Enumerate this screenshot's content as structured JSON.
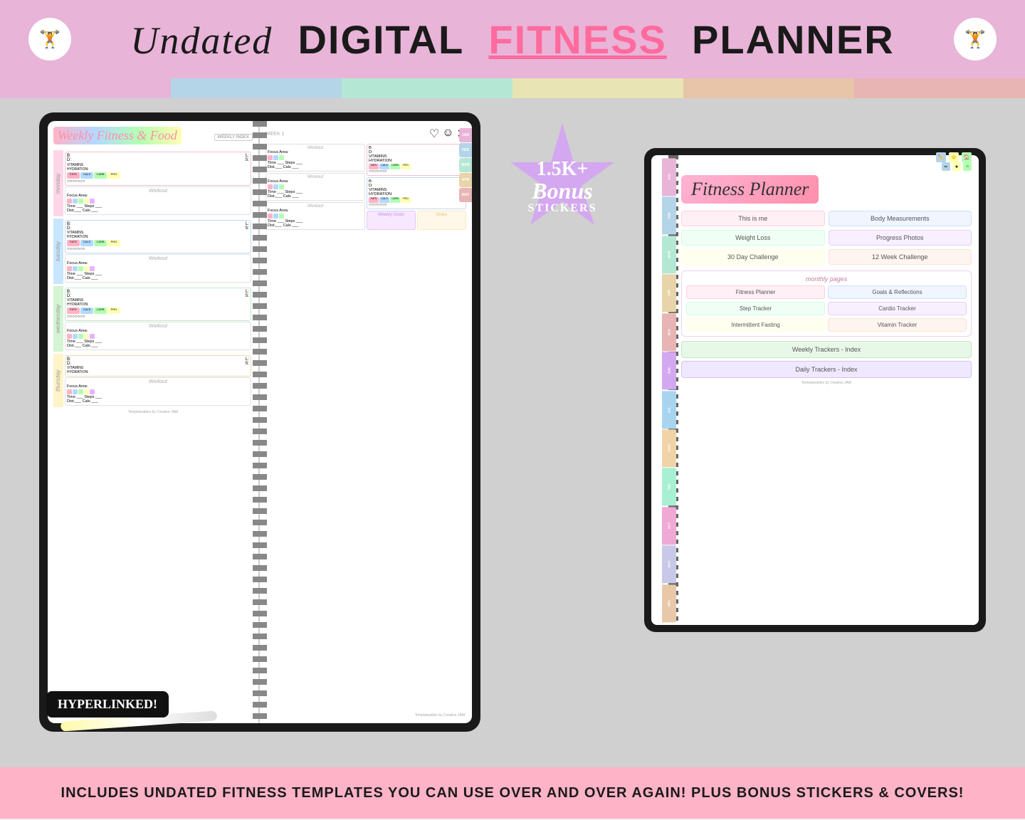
{
  "header": {
    "title_undated": "Undated",
    "title_digital": "DIGITAL",
    "title_fitness": "FITNESS",
    "title_planner": "PLANNER",
    "icon_left": "🏋️",
    "icon_right": "🏋️"
  },
  "color_stripe": {
    "colors": [
      "#e8b4d8",
      "#b4d4e8",
      "#b4e8d4",
      "#e8e4b4",
      "#e8c4a8",
      "#e8b4b4"
    ]
  },
  "bonus": {
    "amount": "1.5K+",
    "label": "Bonus",
    "sublabel": "STICKERS"
  },
  "hyperlinked": "HYPERLINKED!",
  "bottom_bar": {
    "text": "INCLUDES UNDATED FITNESS TEMPLATES YOU CAN USE OVER AND OVER AGAIN! PLUS BONUS STICKERS & COVERS!"
  },
  "planner_left": {
    "title": "Weekly Fitness & Food",
    "weekly_index": "WEEKLY INDEX",
    "week_num": "WEEK 1",
    "days": [
      {
        "label": "monday",
        "color": "#ffd6e7"
      },
      {
        "label": "tuesday",
        "color": "#c8e6ff"
      },
      {
        "label": "wednesday",
        "color": "#d4f4d4"
      },
      {
        "label": "thursday",
        "color": "#fff3c8"
      }
    ],
    "meal_fields": {
      "b": "B:",
      "l": "L:",
      "d": "D:",
      "s": "S:",
      "vitamins": "VITAMINS",
      "hydration": "HYDRATION:",
      "fats": "FATS",
      "carb": "CARB",
      "pro": "PRO"
    },
    "workout_label": "Workout",
    "focus_area": "Focus Area:",
    "time_steps": "Time ___ Steps ___",
    "dist_cals": "Dist ___ Cals ___",
    "weekly_goals": "Weekly Goals",
    "notes": "Notes",
    "footer": "Templateables by Creative JAM"
  },
  "planner_right": {
    "title": "Fitness Planner",
    "sections": {
      "quick_links": [
        "This is me",
        "Body Measurements",
        "Weight Loss",
        "Progress Photos",
        "30 Day Challenge",
        "12 Week Challenge"
      ],
      "monthly_title": "monthly pages",
      "monthly": [
        "Fitness Planner",
        "Goals & Reflections",
        "Step Tracker",
        "Cardio Tracker",
        "Intermittent Fasting",
        "Vitamin Tracker"
      ],
      "trackers_index": "Weekly Trackers - Index",
      "daily_trackers_index": "Daily Trackers - Index"
    },
    "month_tabs": [
      "JAN",
      "FEB",
      "MAR",
      "APR",
      "MAY",
      "JUN",
      "JUL",
      "AUG",
      "SEP",
      "OCT",
      "NOV",
      "DEC"
    ]
  }
}
